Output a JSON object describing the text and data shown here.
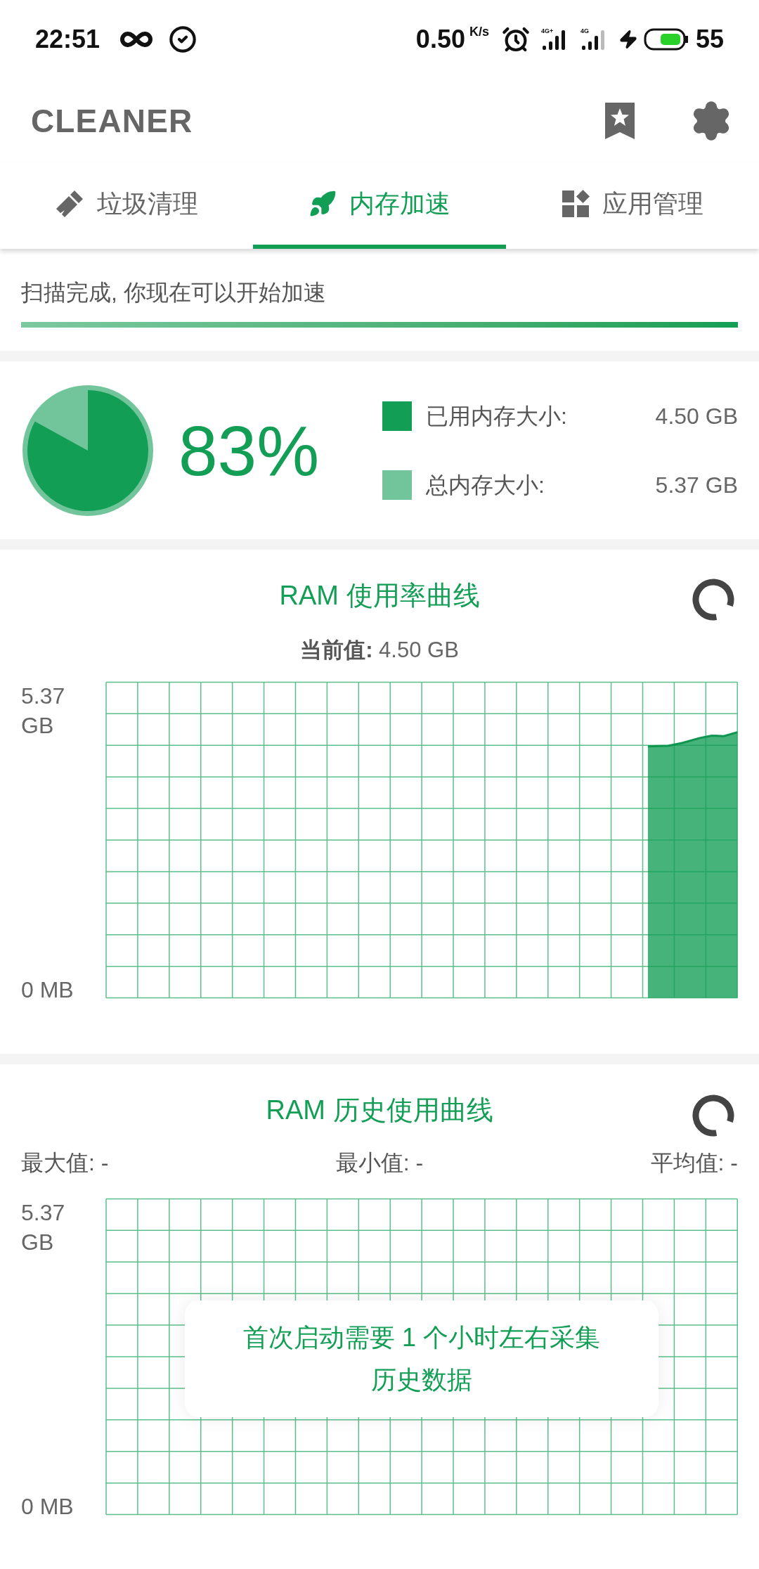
{
  "status_bar": {
    "time": "22:51",
    "speed": "0.50",
    "speed_unit": "K/s",
    "signals": [
      {
        "label": "4G+",
        "weak": false
      },
      {
        "label": "4G",
        "weak": true
      }
    ],
    "battery": "55"
  },
  "app_bar": {
    "title": "CLEANER"
  },
  "tabs": [
    {
      "label": "垃圾清理",
      "selected": false,
      "kind": "broom"
    },
    {
      "label": "内存加速",
      "selected": true,
      "kind": "rocket"
    },
    {
      "label": "应用管理",
      "selected": false,
      "kind": "apps"
    }
  ],
  "scan": {
    "message": "扫描完成, 你现在可以开始加速",
    "level": 1
  },
  "memory": {
    "percent": "83%",
    "legend": [
      {
        "label": "已用内存大小:",
        "value": "4.50 GB",
        "color": "#129e55"
      },
      {
        "label": "总内存大小:",
        "value": "5.37 GB",
        "color": "#72c59a"
      }
    ]
  },
  "usage_chart": {
    "title_prefix": "RAM",
    "title": "使用率曲线",
    "current_label": "当前值:",
    "current_value": "4.50 GB",
    "y_top": "5.37 GB",
    "y_bottom": "0 MB"
  },
  "history_chart": {
    "title_prefix": "RAM",
    "title": "历史使用曲线",
    "stats": [
      {
        "label": "最大值:",
        "value": "-"
      },
      {
        "label": "最小值:",
        "value": "-"
      },
      {
        "label": "平均值:",
        "value": "-"
      }
    ],
    "y_top": "5.37 GB",
    "y_bottom": "0 MB"
  },
  "toast": {
    "message": "首次启动需要 1 个小时左右采集历史数据"
  }
}
